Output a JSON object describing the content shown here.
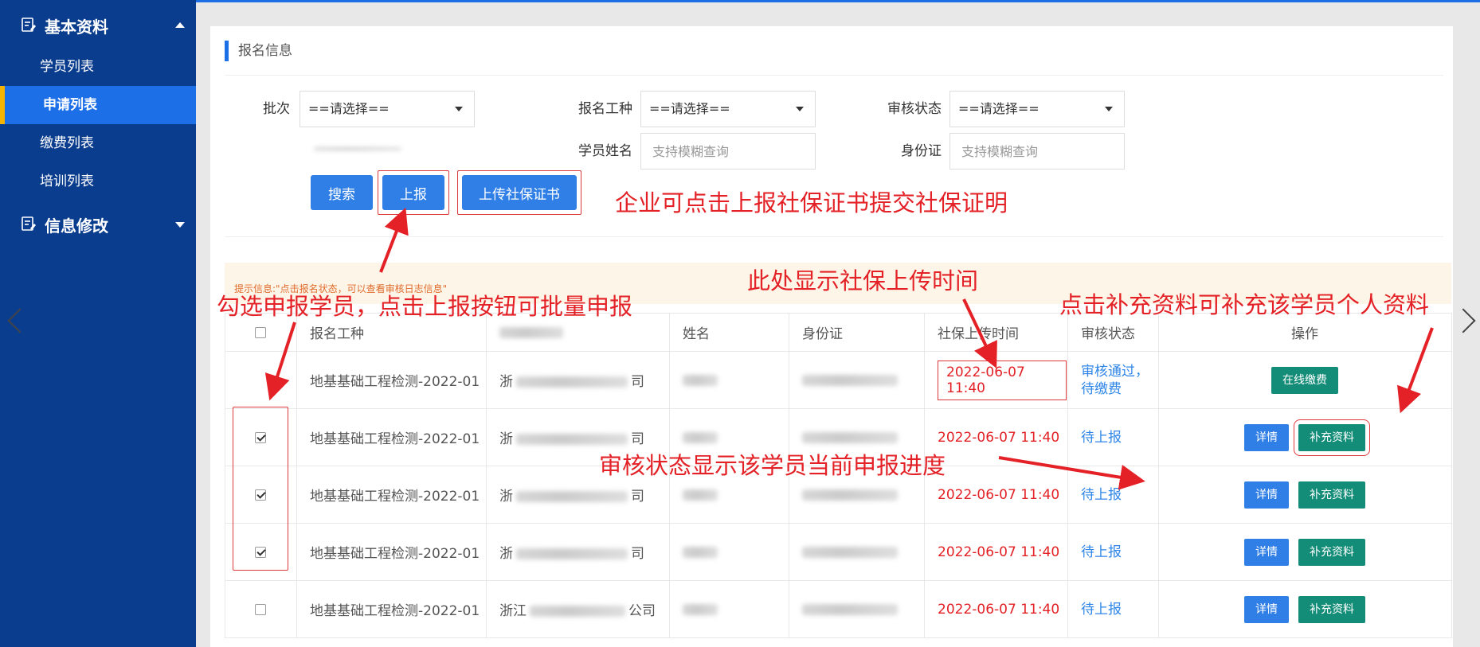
{
  "sidebar": {
    "group1": "基本资料",
    "items": [
      {
        "label": "学员列表"
      },
      {
        "label": "申请列表"
      },
      {
        "label": "缴费列表"
      },
      {
        "label": "培训列表"
      }
    ],
    "group2": "信息修改"
  },
  "main": {
    "section_title": "报名信息",
    "filters": {
      "batch_label": "批次",
      "batch_value": "==请选择==",
      "type_label": "报名工种",
      "type_value": "==请选择==",
      "audit_label": "审核状态",
      "audit_value": "==请选择==",
      "name_label": "学员姓名",
      "name_placeholder": "支持模糊查询",
      "id_label": "身份证",
      "id_placeholder": "支持模糊查询"
    },
    "buttons": {
      "search": "搜索",
      "report": "上报",
      "upload": "上传社保证书"
    },
    "notice": "提示信息:\"点击报名状态，可以查看审核日志信息\"",
    "table": {
      "headers": [
        "报名工种",
        "姓名",
        "身份证",
        "社保上传时间",
        "审核状态",
        "操作"
      ],
      "rows": [
        {
          "type": "地基基础工程检测-2022-01",
          "company_a": "浙",
          "company_b": "司",
          "time": "2022-06-07 11:40",
          "status": "审核通过，",
          "status2": "待缴费",
          "checkbox": "none"
        },
        {
          "type": "地基基础工程检测-2022-01",
          "company_a": "浙",
          "company_b": "司",
          "time": "2022-06-07 11:40",
          "status": "待上报",
          "status2": "",
          "checkbox": "checked"
        },
        {
          "type": "地基基础工程检测-2022-01",
          "company_a": "浙",
          "company_b": "司",
          "time": "2022-06-07 11:40",
          "status": "待上报",
          "status2": "",
          "checkbox": "checked"
        },
        {
          "type": "地基基础工程检测-2022-01",
          "company_a": "浙",
          "company_b": "司",
          "time": "2022-06-07 11:40",
          "status": "待上报",
          "status2": "",
          "checkbox": "checked"
        },
        {
          "type": "地基基础工程检测-2022-01",
          "company_a": "浙江",
          "company_b": "公司",
          "time": "2022-06-07 11:40",
          "status": "待上报",
          "status2": "",
          "checkbox": "unchecked"
        }
      ],
      "op_pay": "在线缴费",
      "op_detail": "详情",
      "op_supplement": "补充资料"
    }
  },
  "annotations": {
    "a1": "企业可点击上报社保证书提交社保证明",
    "a2": "勾选申报学员，点击上报按钮可批量申报",
    "a3": "此处显示社保上传时间",
    "a4": "点击补充资料可补充该学员个人资料",
    "a5": "审核状态显示该学员当前申报进度"
  },
  "colors": {
    "sidebar_bg": "#0b3d8f",
    "accent": "#1d6fe8",
    "annotation_red": "#e32126",
    "green_button": "#138c78"
  }
}
